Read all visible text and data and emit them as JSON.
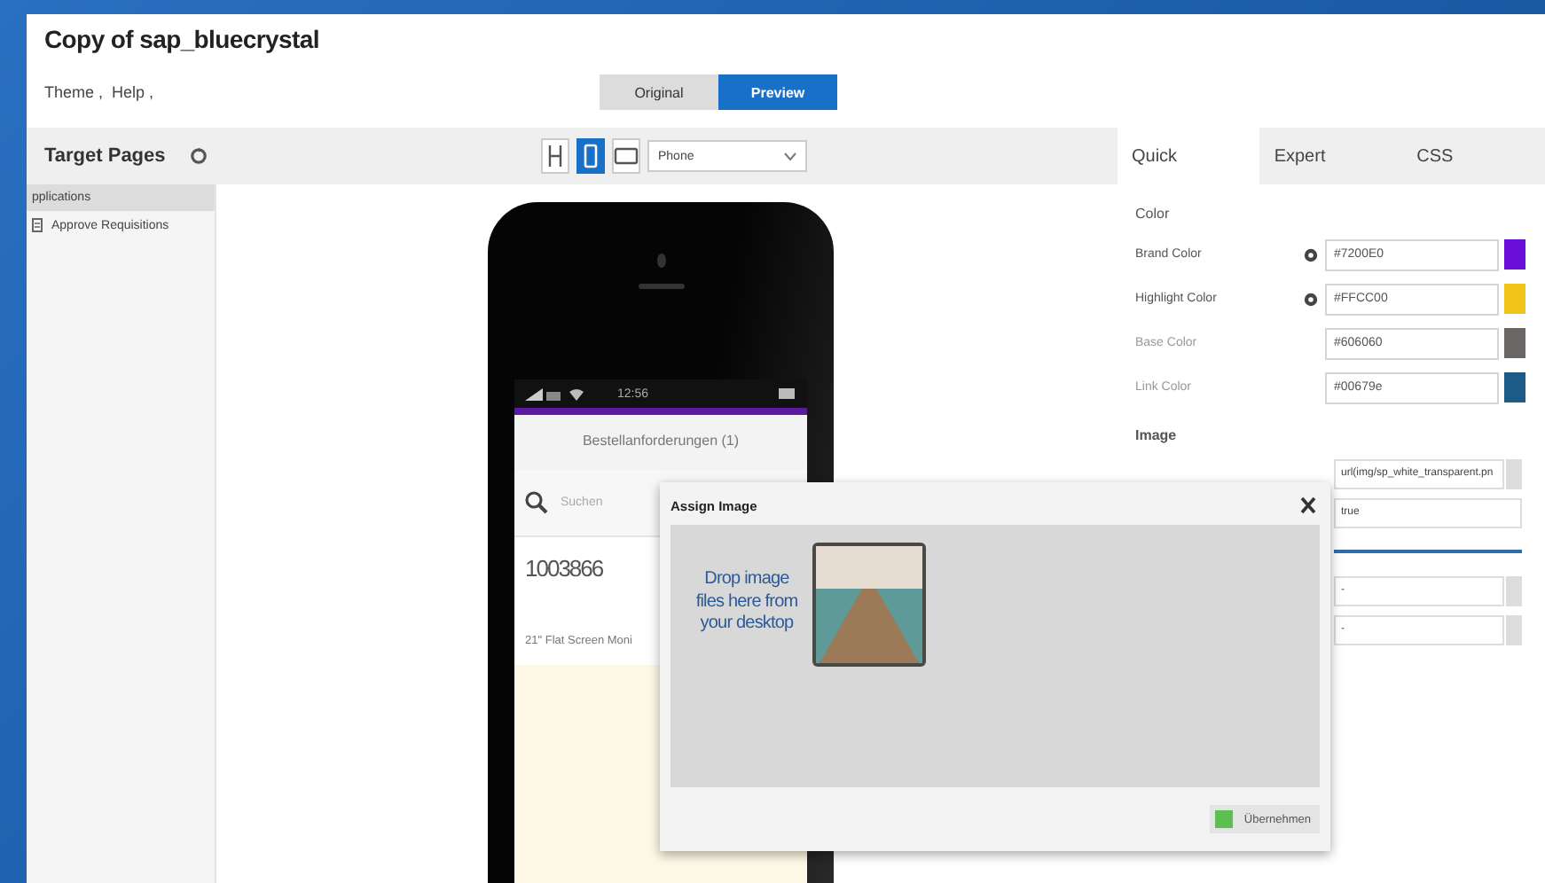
{
  "window": {
    "title": "Copy of sap_bluecrystal"
  },
  "breadcrumbs": [
    "Theme ,",
    "Help ,"
  ],
  "view_toggle": [
    {
      "label": "Original",
      "selected": false
    },
    {
      "label": "Preview",
      "selected": true
    }
  ],
  "target_pages": {
    "title": "Target Pages",
    "items": [
      {
        "label": "pplications",
        "selected": true,
        "children": [
          {
            "label": "Approve Requisitions",
            "selected": false
          }
        ]
      }
    ]
  },
  "device_toolbar": {
    "devices": [
      {
        "kind": "resize",
        "selected": false
      },
      {
        "kind": "phone",
        "selected": true
      },
      {
        "kind": "tablet",
        "selected": false
      }
    ],
    "device_select": "Phone"
  },
  "phone_preview": {
    "time": "12:56",
    "header": "Bestellanforderungen (1)",
    "search_placeholder": "Suchen",
    "item_number": "1003866",
    "item_description": "21\" Flat Screen Moni"
  },
  "tabs": [
    {
      "label": "Quick",
      "selected": true
    },
    {
      "label": "Expert",
      "selected": false
    },
    {
      "label": "CSS",
      "selected": false
    }
  ],
  "color_section": {
    "title": "Color",
    "rows": [
      {
        "label": "Brand Color",
        "value": "#7200E0",
        "color": "#6a0fd8",
        "modified": true
      },
      {
        "label": "Highlight Color",
        "value": "#FFCC00",
        "color": "#f0c419",
        "modified": true
      },
      {
        "label": "Base Color",
        "value": "#606060",
        "color": "#6b6666",
        "modified": false
      },
      {
        "label": "Link Color",
        "value": "#00679e",
        "color": "#1c5a88",
        "modified": false
      }
    ]
  },
  "image_section": {
    "title": "Image",
    "rows": [
      {
        "kind": "text",
        "value": "url(img/sp_white_transparent.pn",
        "button": true
      },
      {
        "kind": "text",
        "value": "true",
        "button": false
      },
      {
        "kind": "slider",
        "level": 1
      },
      {
        "kind": "text",
        "value": "-",
        "button": true
      },
      {
        "kind": "text",
        "value": "-",
        "button": true
      }
    ]
  },
  "dialog": {
    "title": "Assign Image",
    "drop_text": "Drop image files here from your desktop",
    "button": "Übernehmen"
  }
}
